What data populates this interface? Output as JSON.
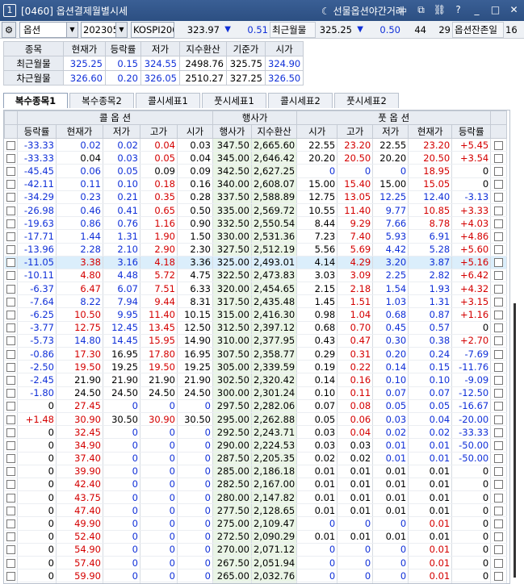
{
  "window": {
    "num": "1",
    "title": "[0460] 옵션결제월별시세",
    "night": "선물옵션야간거래",
    "icons": [
      "layout-icon",
      "restore-icon",
      "link-icon",
      "help-icon",
      "minimize-icon",
      "maximize-icon",
      "close-icon"
    ]
  },
  "toolbar": {
    "type": "옵션",
    "month": "202305",
    "index": "KOSPI200",
    "index_val": "323.97",
    "index_arrow": "▼",
    "index_chg": "0.51",
    "near_label": "최근월물",
    "near_val": "325.25",
    "near_arrow": "▼",
    "near_chg": "0.50",
    "days_a": "44",
    "days_b": "29",
    "remain_label": "옵션잔존일",
    "remain_val": "16"
  },
  "futures": {
    "headers": [
      "종목",
      "현재가",
      "등락률",
      "저가",
      "지수환산",
      "기준가",
      "시가"
    ],
    "rows": [
      [
        "최근월물",
        "325.25",
        "0.15",
        "324.55",
        "2498.76",
        "325.75",
        "324.90"
      ],
      [
        "차근월물",
        "326.60",
        "0.20",
        "326.05",
        "2510.27",
        "327.25",
        "326.50"
      ]
    ]
  },
  "tabs": [
    "복수종목1",
    "복수종목2",
    "콜시세표1",
    "풋시세표1",
    "콜시세표2",
    "풋시세표2"
  ],
  "grid": {
    "group_headers": {
      "call": "콜 옵 션",
      "strike": "행사가",
      "put": "풋 옵 션"
    },
    "headers": [
      "등락률",
      "현재가",
      "저가",
      "고가",
      "시가",
      "행사가",
      "지수환산",
      "시가",
      "고가",
      "저가",
      "현재가",
      "등락률"
    ],
    "rows": [
      [
        "-33.33",
        "0.02",
        "0.02",
        "0.04",
        "0.03",
        "347.50",
        "2,665.60",
        "22.55",
        "23.20",
        "22.55",
        "23.20",
        "+5.45"
      ],
      [
        "-33.33",
        "0.04",
        "0.03",
        "0.05",
        "0.04",
        "345.00",
        "2,646.42",
        "20.20",
        "20.50",
        "20.20",
        "20.50",
        "+3.54"
      ],
      [
        "-45.45",
        "0.06",
        "0.05",
        "0.09",
        "0.09",
        "342.50",
        "2,627.25",
        "0",
        "0",
        "0",
        "18.95",
        "0"
      ],
      [
        "-42.11",
        "0.11",
        "0.10",
        "0.18",
        "0.16",
        "340.00",
        "2,608.07",
        "15.00",
        "15.40",
        "15.00",
        "15.05",
        "0"
      ],
      [
        "-34.29",
        "0.23",
        "0.21",
        "0.35",
        "0.28",
        "337.50",
        "2,588.89",
        "12.75",
        "13.05",
        "12.25",
        "12.40",
        "-3.13"
      ],
      [
        "-26.98",
        "0.46",
        "0.41",
        "0.65",
        "0.50",
        "335.00",
        "2,569.72",
        "10.55",
        "11.40",
        "9.77",
        "10.85",
        "+3.33"
      ],
      [
        "-19.63",
        "0.86",
        "0.76",
        "1.16",
        "0.90",
        "332.50",
        "2,550.54",
        "8.44",
        "9.29",
        "7.66",
        "8.78",
        "+4.03"
      ],
      [
        "-17.71",
        "1.44",
        "1.31",
        "1.90",
        "1.50",
        "330.00",
        "2,531.36",
        "7.23",
        "7.40",
        "5.93",
        "6.91",
        "+4.86"
      ],
      [
        "-13.96",
        "2.28",
        "2.10",
        "2.90",
        "2.30",
        "327.50",
        "2,512.19",
        "5.56",
        "5.69",
        "4.42",
        "5.28",
        "+5.60"
      ],
      [
        "-11.05",
        "3.38",
        "3.16",
        "4.18",
        "3.36",
        "325.00",
        "2,493.01",
        "4.14",
        "4.29",
        "3.20",
        "3.87",
        "+5.16"
      ],
      [
        "-10.11",
        "4.80",
        "4.48",
        "5.72",
        "4.75",
        "322.50",
        "2,473.83",
        "3.03",
        "3.09",
        "2.25",
        "2.82",
        "+6.42"
      ],
      [
        "-6.37",
        "6.47",
        "6.07",
        "7.51",
        "6.33",
        "320.00",
        "2,454.65",
        "2.15",
        "2.18",
        "1.54",
        "1.93",
        "+4.32"
      ],
      [
        "-7.64",
        "8.22",
        "7.94",
        "9.44",
        "8.31",
        "317.50",
        "2,435.48",
        "1.45",
        "1.51",
        "1.03",
        "1.31",
        "+3.15"
      ],
      [
        "-6.25",
        "10.50",
        "9.95",
        "11.40",
        "10.15",
        "315.00",
        "2,416.30",
        "0.98",
        "1.04",
        "0.68",
        "0.87",
        "+1.16"
      ],
      [
        "-3.77",
        "12.75",
        "12.45",
        "13.45",
        "12.50",
        "312.50",
        "2,397.12",
        "0.68",
        "0.70",
        "0.45",
        "0.57",
        "0"
      ],
      [
        "-5.73",
        "14.80",
        "14.45",
        "15.95",
        "14.90",
        "310.00",
        "2,377.95",
        "0.43",
        "0.47",
        "0.30",
        "0.38",
        "+2.70"
      ],
      [
        "-0.86",
        "17.30",
        "16.95",
        "17.80",
        "16.95",
        "307.50",
        "2,358.77",
        "0.29",
        "0.31",
        "0.20",
        "0.24",
        "-7.69"
      ],
      [
        "-2.50",
        "19.50",
        "19.25",
        "19.50",
        "19.25",
        "305.00",
        "2,339.59",
        "0.19",
        "0.22",
        "0.14",
        "0.15",
        "-11.76"
      ],
      [
        "-2.45",
        "21.90",
        "21.90",
        "21.90",
        "21.90",
        "302.50",
        "2,320.42",
        "0.14",
        "0.16",
        "0.10",
        "0.10",
        "-9.09"
      ],
      [
        "-1.80",
        "24.50",
        "24.50",
        "24.50",
        "24.50",
        "300.00",
        "2,301.24",
        "0.10",
        "0.11",
        "0.07",
        "0.07",
        "-12.50"
      ],
      [
        "0",
        "27.45",
        "0",
        "0",
        "0",
        "297.50",
        "2,282.06",
        "0.07",
        "0.08",
        "0.05",
        "0.05",
        "-16.67"
      ],
      [
        "+1.48",
        "30.90",
        "30.50",
        "30.90",
        "30.50",
        "295.00",
        "2,262.88",
        "0.05",
        "0.06",
        "0.03",
        "0.04",
        "-20.00"
      ],
      [
        "0",
        "32.45",
        "0",
        "0",
        "0",
        "292.50",
        "2,243.71",
        "0.03",
        "0.04",
        "0.02",
        "0.02",
        "-33.33"
      ],
      [
        "0",
        "34.90",
        "0",
        "0",
        "0",
        "290.00",
        "2,224.53",
        "0.03",
        "0.03",
        "0.01",
        "0.01",
        "-50.00"
      ],
      [
        "0",
        "37.40",
        "0",
        "0",
        "0",
        "287.50",
        "2,205.35",
        "0.02",
        "0.02",
        "0.01",
        "0.01",
        "-50.00"
      ],
      [
        "0",
        "39.90",
        "0",
        "0",
        "0",
        "285.00",
        "2,186.18",
        "0.01",
        "0.01",
        "0.01",
        "0.01",
        "0"
      ],
      [
        "0",
        "42.40",
        "0",
        "0",
        "0",
        "282.50",
        "2,167.00",
        "0.01",
        "0.01",
        "0.01",
        "0.01",
        "0"
      ],
      [
        "0",
        "43.75",
        "0",
        "0",
        "0",
        "280.00",
        "2,147.82",
        "0.01",
        "0.01",
        "0.01",
        "0.01",
        "0"
      ],
      [
        "0",
        "47.40",
        "0",
        "0",
        "0",
        "277.50",
        "2,128.65",
        "0.01",
        "0.01",
        "0.01",
        "0.01",
        "0"
      ],
      [
        "0",
        "49.90",
        "0",
        "0",
        "0",
        "275.00",
        "2,109.47",
        "0",
        "0",
        "0",
        "0.01",
        "0"
      ],
      [
        "0",
        "52.40",
        "0",
        "0",
        "0",
        "272.50",
        "2,090.29",
        "0.01",
        "0.01",
        "0.01",
        "0.01",
        "0"
      ],
      [
        "0",
        "54.90",
        "0",
        "0",
        "0",
        "270.00",
        "2,071.12",
        "0",
        "0",
        "0",
        "0.01",
        "0"
      ],
      [
        "0",
        "57.40",
        "0",
        "0",
        "0",
        "267.50",
        "2,051.94",
        "0",
        "0",
        "0",
        "0.01",
        "0"
      ],
      [
        "0",
        "59.90",
        "0",
        "0",
        "0",
        "265.00",
        "2,032.76",
        "0",
        "0",
        "0",
        "0.01",
        "0"
      ],
      [
        "0",
        "62.40",
        "0",
        "0",
        "0",
        "262.50",
        "2,013.58",
        "0",
        "0",
        "0",
        "0.01",
        "0"
      ]
    ],
    "selected_strike": "325.00"
  },
  "colors": {
    "up": "#d40000",
    "down": "#1030d8",
    "flat": "#000000",
    "strike_bg": "#eaf5e6",
    "selected_bg": "#dbeefb",
    "title_bg": "#2c4f82"
  }
}
